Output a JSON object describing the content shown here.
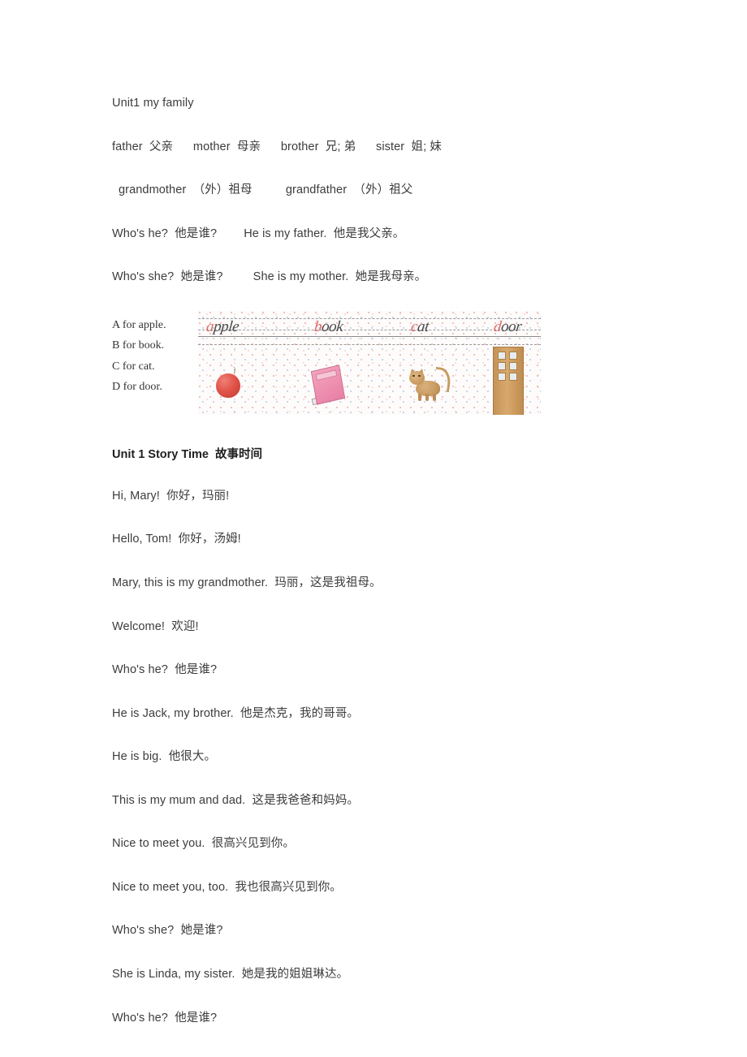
{
  "document": {
    "title": "Unit1 my family",
    "vocab_line": "father  父亲      mother  母亲      brother  兄; 弟      sister  姐; 妹",
    "vocab_line2": "grandmother  （外）祖母          grandfather  （外）祖父",
    "qa_father": "Who's he?  他是谁?        He is my father.  他是我父亲。",
    "qa_mother": "Who's she?  她是谁?         She is my mother.  她是我母亲。"
  },
  "alphabet": {
    "lines": [
      "A for apple.",
      "B for book.",
      "C for cat.",
      "D for door."
    ],
    "handwriting": [
      {
        "cap": "a",
        "rest": "pple"
      },
      {
        "cap": "b",
        "rest": "ook"
      },
      {
        "cap": "c",
        "rest": "at"
      },
      {
        "cap": "d",
        "rest": "oor"
      }
    ],
    "illustrations": [
      "apple",
      "book",
      "cat",
      "door"
    ],
    "ink_color": "#e06a64"
  },
  "story": {
    "heading": "Unit 1 Story Time  故事时间",
    "lines": [
      "Hi, Mary!  你好，玛丽!",
      "Hello, Tom!  你好，汤姆!",
      "Mary, this is my grandmother.  玛丽，这是我祖母。",
      "Welcome!  欢迎!",
      "Who's he?  他是谁?",
      "He is Jack, my brother.  他是杰克，我的哥哥。",
      "He is big.  他很大。",
      "This is my mum and dad.  这是我爸爸和妈妈。",
      "Nice to meet you.  很高兴见到你。",
      "Nice to meet you, too.  我也很高兴见到你。",
      "Who's she?  她是谁?",
      "She is Linda, my sister.  她是我的姐姐琳达。",
      "Who's he?  他是谁?"
    ]
  }
}
